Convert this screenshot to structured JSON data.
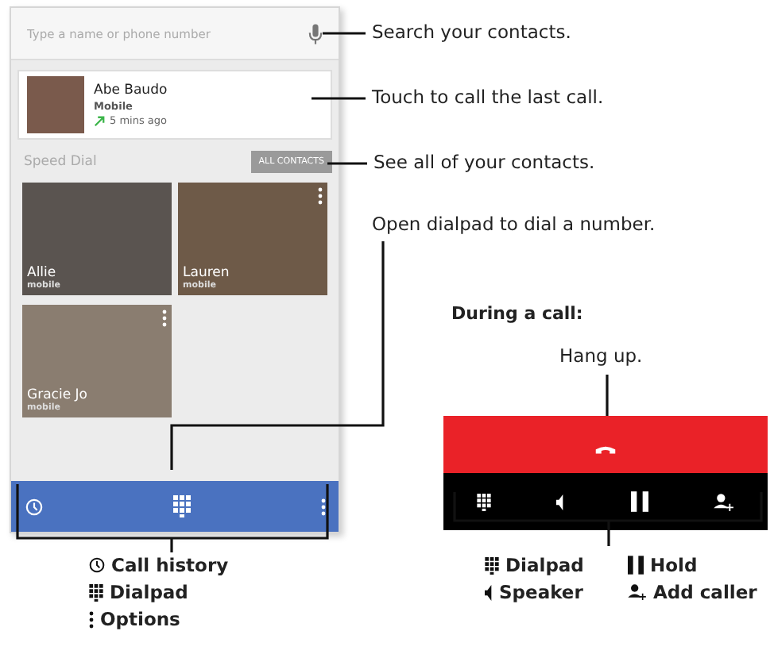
{
  "dialer": {
    "search": {
      "placeholder": "Type a name or phone number"
    },
    "recent_call": {
      "name": "Abe Baudo",
      "type": "Mobile",
      "time": "5 mins ago"
    },
    "speed_dial": {
      "title": "Speed Dial",
      "button": "ALL CONTACTS",
      "contacts": [
        {
          "name": "Allie",
          "label": "mobile",
          "has_menu": false
        },
        {
          "name": "Lauren",
          "label": "mobile",
          "has_menu": true
        },
        {
          "name": "Gracie Jo",
          "label": "mobile",
          "has_menu": true
        }
      ]
    }
  },
  "callouts": [
    {
      "text": "Search your contacts."
    },
    {
      "text": "Touch to call the last call."
    },
    {
      "text": "See all of your contacts."
    },
    {
      "text": "Open dialpad to dial a number."
    }
  ],
  "during_call": {
    "title": "During a call:",
    "hang_up_label": "Hang up."
  },
  "legend_left": [
    {
      "kind": "clock",
      "label": "Call history"
    },
    {
      "kind": "dialpad",
      "label": "Dialpad"
    },
    {
      "kind": "more",
      "label": "Options"
    }
  ],
  "legend_right": [
    {
      "kind": "dialpad",
      "label": "Dialpad"
    },
    {
      "kind": "hold",
      "label": "Hold"
    },
    {
      "kind": "speaker",
      "label": "Speaker"
    },
    {
      "kind": "add-person",
      "label": "Add caller"
    }
  ]
}
